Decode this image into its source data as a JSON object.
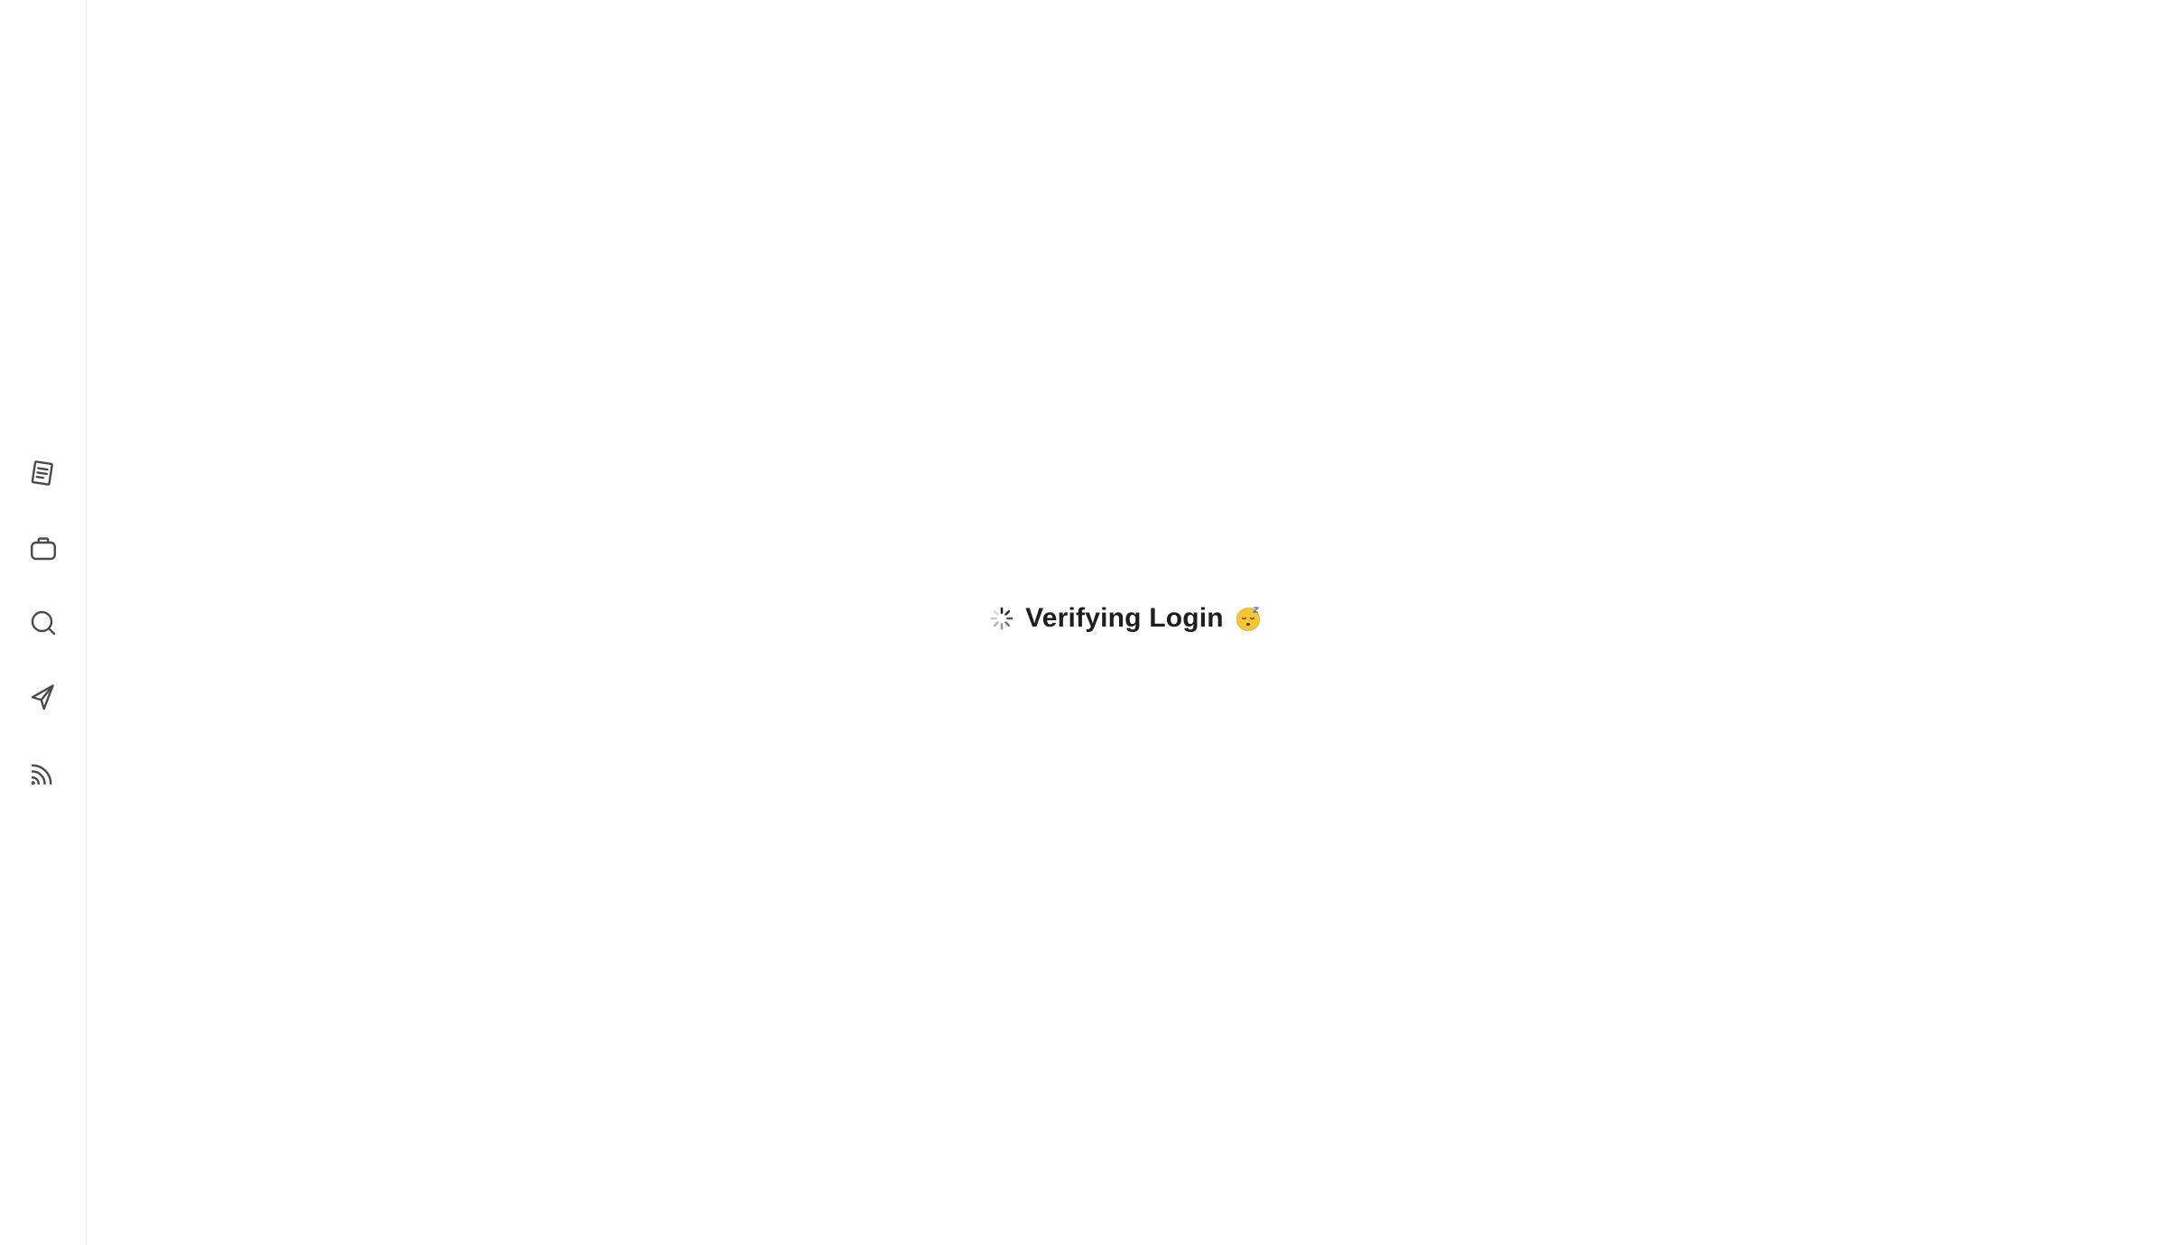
{
  "sidebar": {
    "items": [
      {
        "icon": "document-icon",
        "label": ""
      },
      {
        "icon": "briefcase-icon",
        "label": ""
      },
      {
        "icon": "search-icon",
        "label": ""
      },
      {
        "icon": "send-icon",
        "label": ""
      },
      {
        "icon": "rss-feed-icon",
        "label": ""
      }
    ]
  },
  "main": {
    "status_text": "Verifying Login",
    "spinner_icon": "loading-spinner-icon",
    "emoji_icon": "sleepy-face-emoji-icon"
  },
  "colors": {
    "background": "#ffffff",
    "sidebar_border": "#ededed",
    "icon": "#4a4a4a",
    "text": "#1e1e1e",
    "emoji_face": "#f7c636"
  }
}
